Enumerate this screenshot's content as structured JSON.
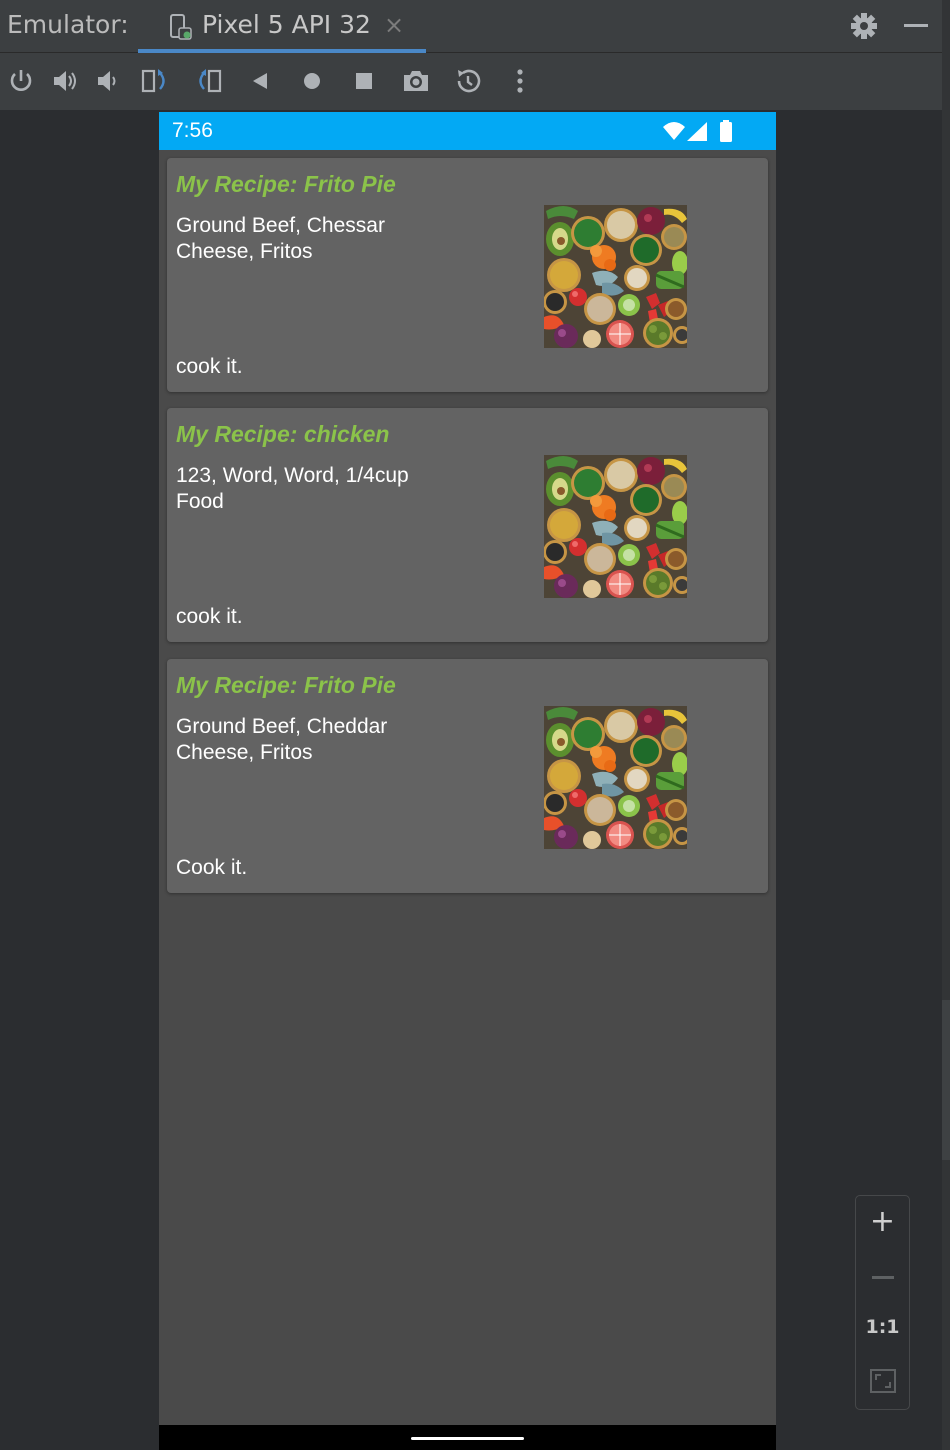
{
  "app": {
    "panel_title": "Emulator:"
  },
  "tab": {
    "label": "Pixel 5 API 32",
    "close_glyph": "×"
  },
  "toolbar": {
    "buttons": [
      "power-icon",
      "volume-up-icon",
      "volume-down-icon",
      "rotate-left-icon",
      "rotate-right-icon",
      "back-icon",
      "home-icon",
      "overview-icon",
      "screenshot-icon",
      "snapshot-icon",
      "more-icon"
    ]
  },
  "device": {
    "status_time": "7:56",
    "status_color": "#03a9f4",
    "cards": [
      {
        "title": "My Recipe: Frito Pie",
        "ingredients": "Ground Beef, Chessar Cheese, Fritos",
        "instructions": "cook it."
      },
      {
        "title": "My Recipe: chicken",
        "ingredients": "123, Word, Word, 1/4cup Food",
        "instructions": "cook it."
      },
      {
        "title": "My Recipe: Frito Pie",
        "ingredients": "Ground Beef, Cheddar Cheese, Fritos",
        "instructions": "Cook it."
      }
    ]
  },
  "zoom": {
    "plus": "+",
    "one_to_one": "1:1"
  },
  "colors": {
    "accent": "#4a88c7",
    "recipe_title": "#8bc34a"
  }
}
